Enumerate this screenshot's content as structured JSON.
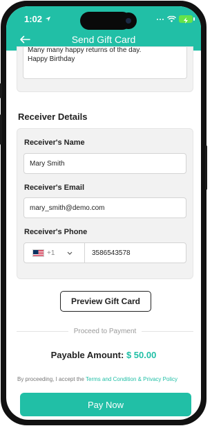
{
  "status_bar": {
    "time": "1:02",
    "location_icon": "location-arrow-icon",
    "wifi_icon": "wifi-icon",
    "battery_icon": "battery-charging-icon",
    "accent": "#21bfa6"
  },
  "header": {
    "title": "Send Gift Card",
    "back_icon": "arrow-left-icon"
  },
  "message": {
    "line1": "Many many happy returns of the day.",
    "line2": "Happy Birthday"
  },
  "receiver": {
    "section_title": "Receiver Details",
    "name_label": "Receiver's Name",
    "name_value": "Mary Smith",
    "email_label": "Receiver's Email",
    "email_value": "mary_smith@demo.com",
    "phone_label": "Receiver's Phone",
    "country_code": "+1",
    "flag_icon": "us-flag-icon",
    "phone_value": "3586543578"
  },
  "preview_button": "Preview Gift Card",
  "proceed_label": "Proceed to Payment",
  "payable": {
    "label": "Payable Amount:",
    "amount": "$ 50.00"
  },
  "terms": {
    "prefix": "By proceeding, I accept the",
    "link": "Terms and Condition & Privacy Policy"
  },
  "pay_button": "Pay Now"
}
